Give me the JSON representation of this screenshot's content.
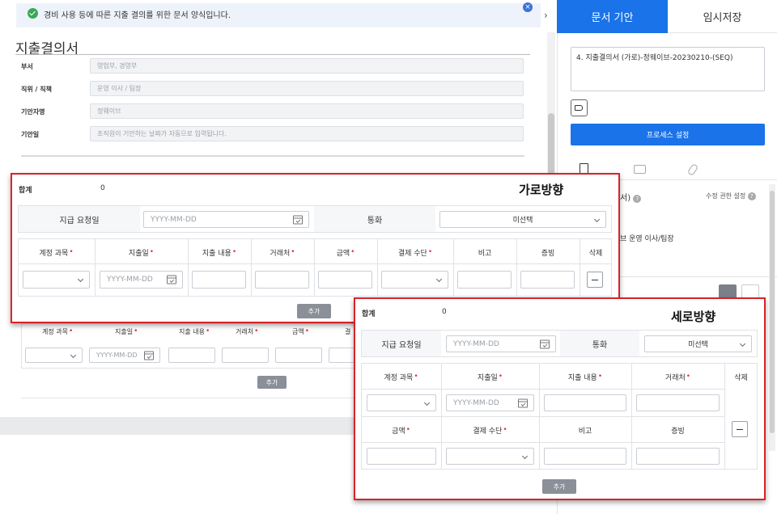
{
  "notice": {
    "text": "경비 사용 등에 따른 지출 결의를 위한 문서 양식입니다."
  },
  "form": {
    "title": "지출결의서",
    "fields": [
      {
        "label": "부서",
        "value": "영업부, 경영부"
      },
      {
        "label": "직위 / 직책",
        "value": "운영 이사 / 팀장"
      },
      {
        "label": "기안자명",
        "value": "정웨이브"
      },
      {
        "label": "기안일",
        "value": "조직원이 기안하는 날짜가 자동으로 입력됩니다."
      }
    ],
    "bg_table": {
      "headers": [
        "계정 과목",
        "지출일",
        "지출 내용",
        "거래처",
        "금액",
        "결"
      ],
      "date_placeholder": "YYYY-MM-DD",
      "add_label": "추가"
    }
  },
  "horizontal": {
    "title": "가로방향",
    "total_label": "합계",
    "total_value": "0",
    "payment_date_label": "지급 요청일",
    "date_placeholder": "YYYY-MM-DD",
    "currency_label": "통화",
    "currency_value": "미선택",
    "headers": [
      "계정 과목",
      "지출일",
      "지출 내용",
      "거래처",
      "금액",
      "결제 수단",
      "비고",
      "증빙",
      "삭제"
    ],
    "required": [
      true,
      true,
      true,
      true,
      true,
      true,
      false,
      false,
      false
    ],
    "add_label": "추가"
  },
  "vertical": {
    "title": "세로방향",
    "total_label": "합계",
    "total_value": "0",
    "payment_date_label": "지급 요청일",
    "date_placeholder": "YYYY-MM-DD",
    "currency_label": "통화",
    "currency_value": "미선택",
    "headers_row1": [
      "계정 과목",
      "지출일",
      "지출 내용",
      "거래처"
    ],
    "headers_row2": [
      "금액",
      "결제 수단",
      "비고",
      "증빙"
    ],
    "delete_label": "삭제",
    "add_label": "추가"
  },
  "sidebar": {
    "tab_active": "문서 기안",
    "tab_inactive": "임시저장",
    "doc_title": "4. 지출결의서 (가로)-정웨이브-20230210-(SEQ)",
    "process_button": "프로세스 설정",
    "approval_partial": "서)",
    "permission_label": "수정 권한 설정",
    "approver_text": "브 운영 이사/팀장"
  },
  "colors": {
    "accent": "#1a73e8",
    "highlight": "#d8232a",
    "notice_bg": "#eef3fb"
  }
}
